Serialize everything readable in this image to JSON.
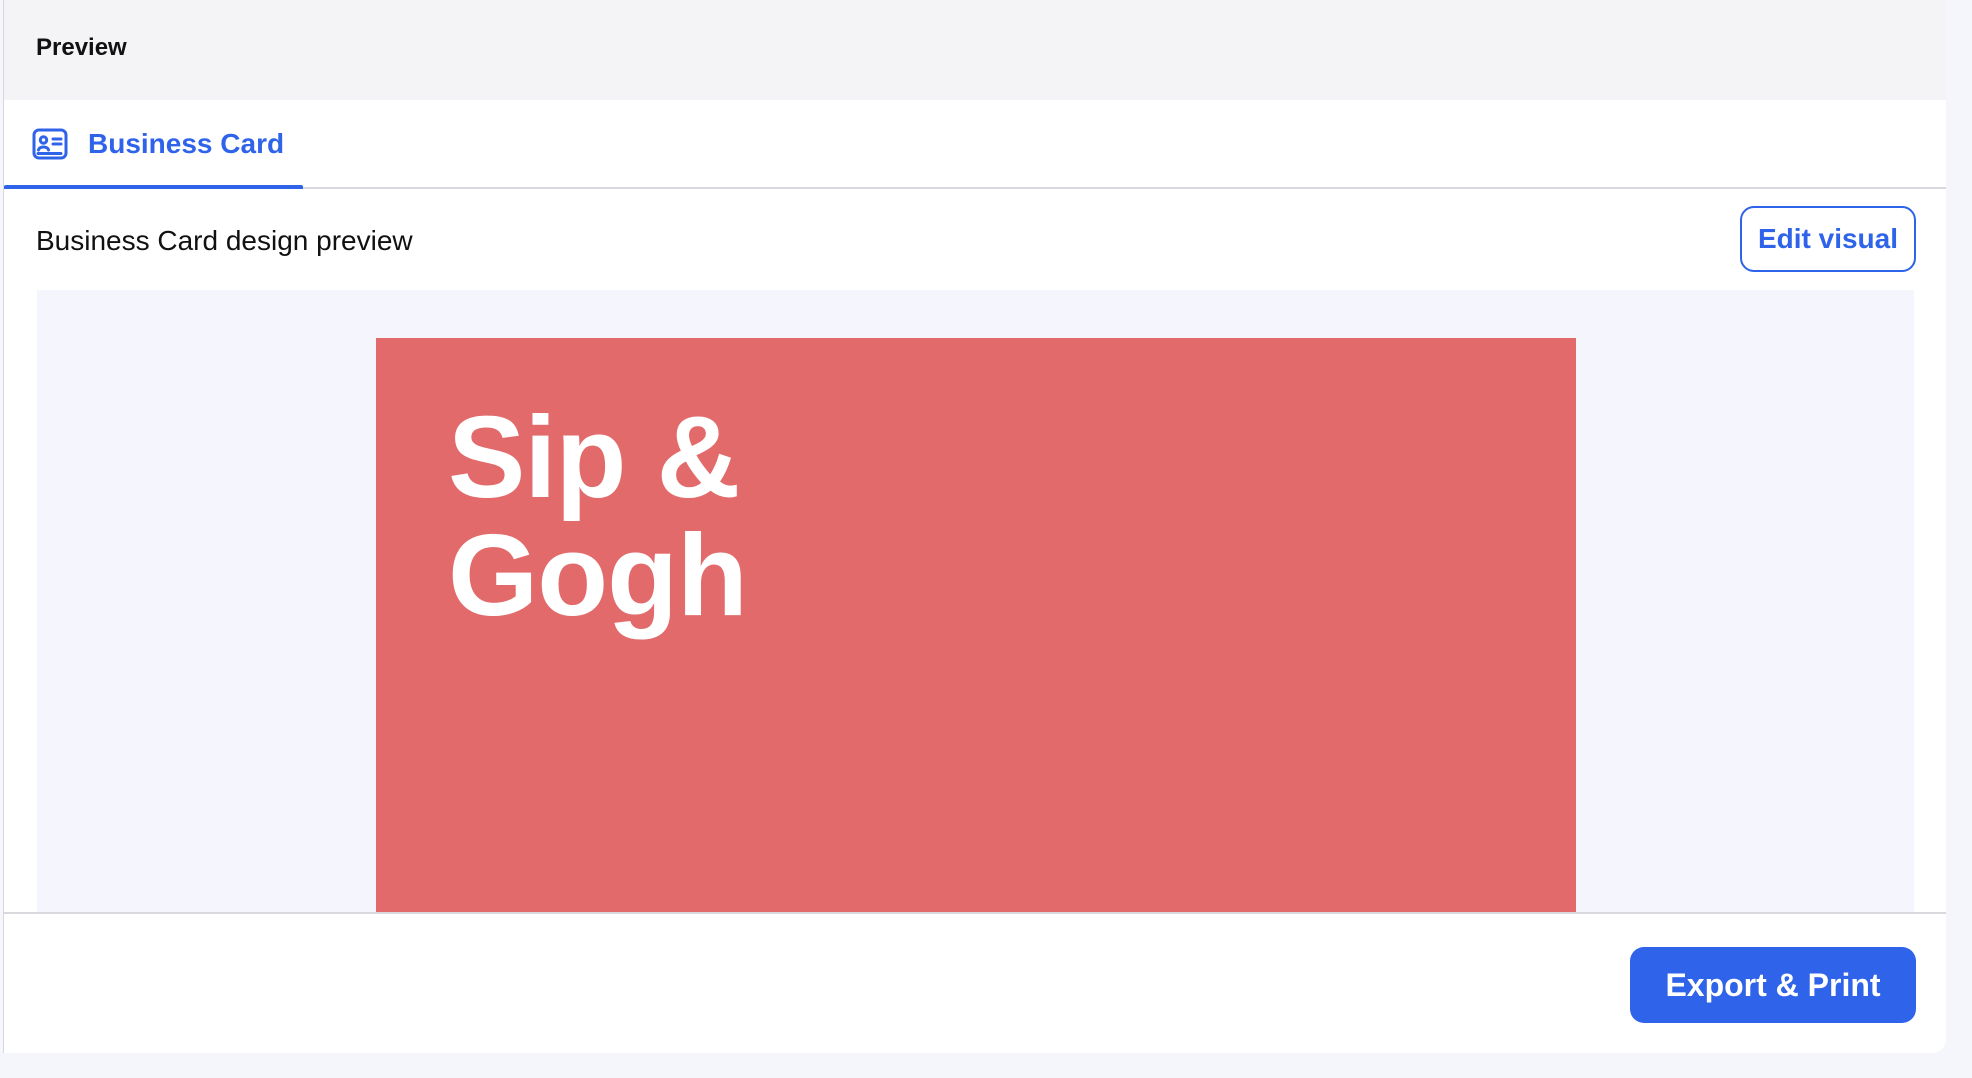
{
  "header": {
    "title": "Preview"
  },
  "tabs": [
    {
      "label": "Business Card",
      "icon": "id-card-icon",
      "active": true
    }
  ],
  "section": {
    "title": "Business Card design preview",
    "edit_button_label": "Edit visual"
  },
  "card": {
    "title_line_1": "Sip &",
    "title_line_2": "Gogh",
    "background_color": "#e26a6b",
    "text_color": "#ffffff"
  },
  "footer": {
    "export_button_label": "Export & Print"
  },
  "colors": {
    "accent": "#2f63e9",
    "header_bg": "#f4f4f6",
    "preview_bg": "#f5f6fd"
  }
}
